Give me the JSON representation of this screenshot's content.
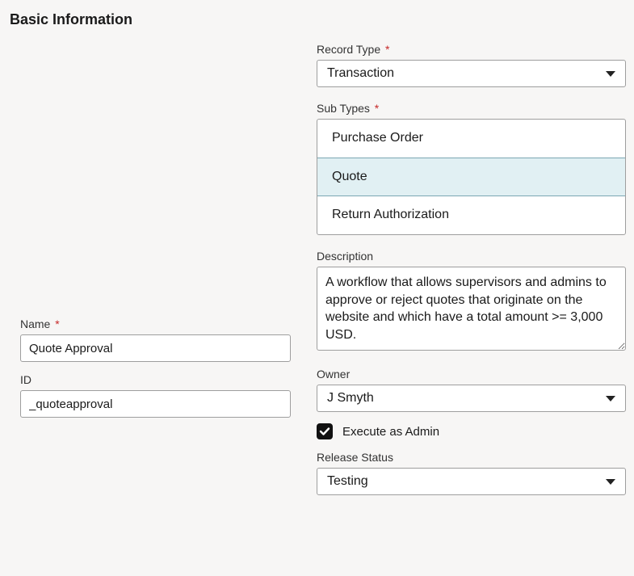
{
  "section_title": "Basic Information",
  "left": {
    "name": {
      "label": "Name",
      "required": true,
      "value": "Quote Approval"
    },
    "id": {
      "label": "ID",
      "required": false,
      "value": "_quoteapproval"
    }
  },
  "right": {
    "record_type": {
      "label": "Record Type",
      "required": true,
      "selected": "Transaction"
    },
    "sub_types": {
      "label": "Sub Types",
      "required": true,
      "options": [
        {
          "label": "Purchase Order",
          "selected": false
        },
        {
          "label": "Quote",
          "selected": true
        },
        {
          "label": "Return Authorization",
          "selected": false
        }
      ]
    },
    "description": {
      "label": "Description",
      "value": "A workflow that allows supervisors and admins to approve or reject quotes that originate on the website and which have a total amount >= 3,000 USD."
    },
    "owner": {
      "label": "Owner",
      "selected": "J Smyth"
    },
    "execute_as_admin": {
      "label": "Execute as Admin",
      "checked": true
    },
    "release_status": {
      "label": "Release Status",
      "selected": "Testing"
    }
  },
  "required_marker": "*"
}
